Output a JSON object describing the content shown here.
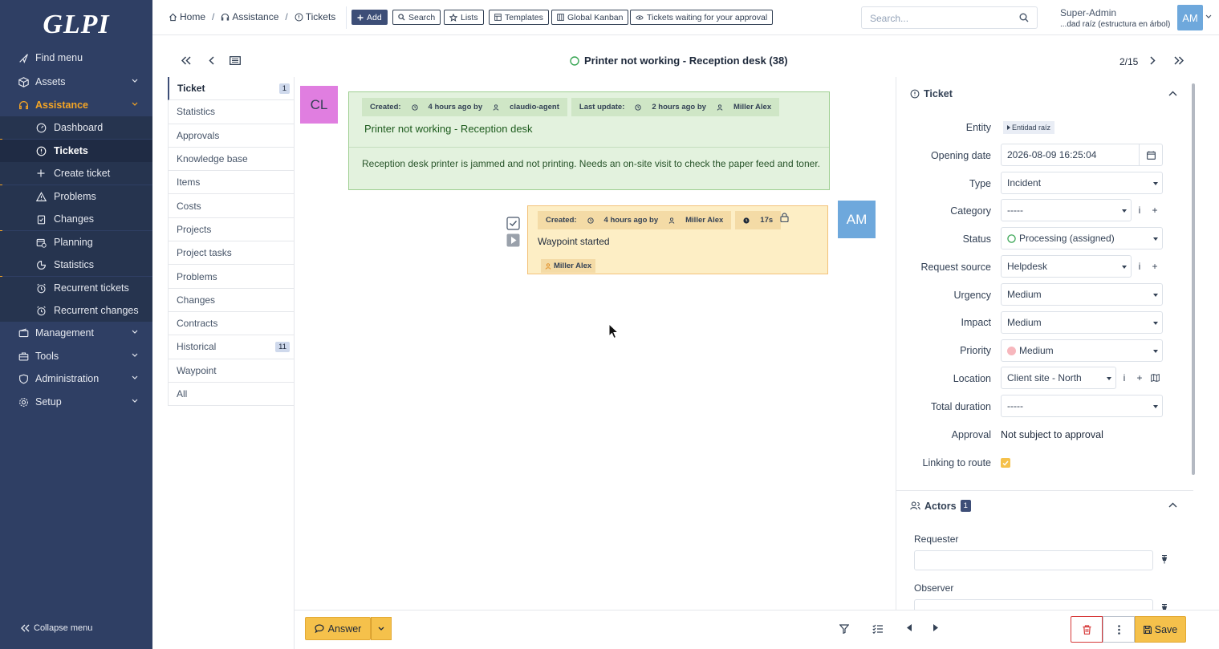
{
  "app": {
    "logo": "GLPI"
  },
  "sidebar": {
    "find_menu": "Find menu",
    "items": [
      {
        "label": "Assets"
      },
      {
        "label": "Assistance"
      },
      {
        "label": "Management"
      },
      {
        "label": "Tools"
      },
      {
        "label": "Administration"
      },
      {
        "label": "Setup"
      }
    ],
    "sub_items": [
      {
        "label": "Dashboard"
      },
      {
        "label": "Tickets"
      },
      {
        "label": "Create ticket"
      },
      {
        "label": "Problems"
      },
      {
        "label": "Changes"
      },
      {
        "label": "Planning"
      },
      {
        "label": "Statistics"
      },
      {
        "label": "Recurrent tickets"
      },
      {
        "label": "Recurrent changes"
      }
    ],
    "collapse": "Collapse menu"
  },
  "breadcrumb": {
    "home": "Home",
    "assistance": "Assistance",
    "tickets": "Tickets",
    "sep": "/"
  },
  "toolbar": {
    "add": "Add",
    "search": "Search",
    "lists": "Lists",
    "templates": "Templates",
    "kanban": "Global Kanban",
    "approval": "Tickets waiting for your approval"
  },
  "search": {
    "placeholder": "Search..."
  },
  "user": {
    "name": "Super-Admin",
    "entity": "...dad raíz (estructura en árbol)",
    "initials": "AM"
  },
  "ticket": {
    "title": "Printer not working - Reception desk (38)",
    "pager": "2/15"
  },
  "tabs": [
    {
      "label": "Ticket",
      "badge": "1"
    },
    {
      "label": "Statistics"
    },
    {
      "label": "Approvals"
    },
    {
      "label": "Knowledge base"
    },
    {
      "label": "Items"
    },
    {
      "label": "Costs"
    },
    {
      "label": "Projects"
    },
    {
      "label": "Project tasks"
    },
    {
      "label": "Problems"
    },
    {
      "label": "Changes"
    },
    {
      "label": "Contracts"
    },
    {
      "label": "Historical",
      "badge": "11"
    },
    {
      "label": "Waypoint"
    },
    {
      "label": "All"
    }
  ],
  "timeline": {
    "main": {
      "avatar": "CL",
      "created_label": "Created:",
      "created_time": "4 hours ago by",
      "created_by": "claudio-agent",
      "update_label": "Last update:",
      "update_time": "2 hours ago by",
      "update_by": "Miller Alex",
      "title": "Printer not working - Reception desk",
      "body": "Reception desk printer is jammed and not printing. Needs an on-site visit to check the paper feed and toner."
    },
    "waypoint": {
      "avatar": "AM",
      "created_label": "Created:",
      "created_time": "4 hours ago by",
      "created_by": "Miller Alex",
      "duration": "17s",
      "text": "Waypoint started",
      "user": "Miller Alex"
    }
  },
  "footer": {
    "answer": "Answer",
    "save": "Save"
  },
  "right_panel": {
    "ticket_section": "Ticket",
    "fields": {
      "entity_label": "Entity",
      "entity_value": "Entidad raíz",
      "opening_label": "Opening date",
      "opening_value": "2026-08-09 16:25:04",
      "type_label": "Type",
      "type_value": "Incident",
      "category_label": "Category",
      "category_value": "-----",
      "status_label": "Status",
      "status_value": "Processing (assigned)",
      "source_label": "Request source",
      "source_value": "Helpdesk",
      "urgency_label": "Urgency",
      "urgency_value": "Medium",
      "impact_label": "Impact",
      "impact_value": "Medium",
      "priority_label": "Priority",
      "priority_value": "Medium",
      "location_label": "Location",
      "location_value": "Client site - North",
      "duration_label": "Total duration",
      "duration_value": "-----",
      "approval_label": "Approval",
      "approval_value": "Not subject to approval",
      "linking_label": "Linking to route"
    },
    "actors_section": "Actors",
    "actors_count": "1",
    "requester_label": "Requester",
    "observer_label": "Observer",
    "info_glyph": "i",
    "plus_glyph": "+"
  },
  "colors": {
    "sidebar": "#2f3f64",
    "accent": "#f5a524",
    "followup": "#e3f2de",
    "waypoint": "#fdeec5"
  }
}
